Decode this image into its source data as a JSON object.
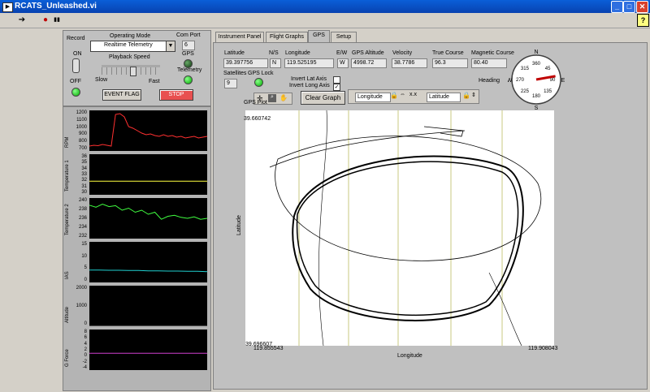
{
  "window": {
    "title": "RCATS_Unleashed.vi",
    "min": "_",
    "max": "□",
    "close": "✕",
    "help": "?"
  },
  "toolbar": {
    "run": "➔",
    "abort": "●",
    "pause": "▮▮"
  },
  "controls": {
    "record_label": "Record",
    "on_label": "ON",
    "off_label": "OFF",
    "operating_mode_label": "Operating Mode",
    "operating_mode_value": "Realtime Telemetry",
    "com_port_label": "Com Port",
    "com_port_value": "6",
    "gps_label": "GPS",
    "telemetry_label": "Telemetry",
    "playback_speed_label": "Playback Speed",
    "slow_label": "Slow",
    "fast_label": "Fast",
    "event_flag_label": "EVENT FLAG",
    "stop_label": "STOP"
  },
  "strip_charts": [
    {
      "name": "RPM",
      "ticks": [
        "1200",
        "1100",
        "1000",
        "900",
        "800",
        "700"
      ],
      "trace_color": "#ff3030",
      "values": [
        760,
        770,
        765,
        780,
        770,
        760,
        1150,
        1160,
        1120,
        1000,
        980,
        950,
        920,
        900,
        910,
        890,
        880,
        900,
        880,
        890,
        870,
        880,
        860,
        870,
        880,
        860,
        870,
        880
      ]
    },
    {
      "name": "Temperature 1",
      "ticks": [
        "36",
        "35",
        "34",
        "33",
        "32",
        "31",
        "30"
      ],
      "trace_color": "#ffff40",
      "values": [
        32,
        32,
        32,
        32,
        32,
        32,
        32,
        32,
        32,
        32,
        32,
        32,
        32,
        32
      ]
    },
    {
      "name": "Temperature 2",
      "ticks": [
        "240",
        "238",
        "236",
        "234",
        "232"
      ],
      "trace_color": "#40ff40",
      "values": [
        238.6,
        238.2,
        238.8,
        238.3,
        238.5,
        237.6,
        238.0,
        237.2,
        237.6,
        236.8,
        237.2,
        235.8,
        236.4,
        236.6,
        236.2,
        236.0,
        236.3,
        235.8,
        236.0
      ]
    },
    {
      "name": "IAS",
      "ticks": [
        "15",
        "10",
        "5",
        "0"
      ],
      "trace_color": "#20d0d0",
      "values": [
        4.6,
        4.6,
        4.5,
        4.5,
        4.4,
        4.4,
        4.3,
        4.3,
        4.2,
        4.2,
        4.1,
        4.1,
        4.0
      ]
    },
    {
      "name": "Altitude",
      "ticks": [
        "2000",
        "1000",
        "0"
      ],
      "trace_color": "#a0a0a0",
      "values": [
        0,
        0,
        0,
        0,
        0,
        0
      ]
    },
    {
      "name": "G Force",
      "ticks": [
        "8",
        "6",
        "4",
        "2",
        "0",
        "-2",
        "-4"
      ],
      "trace_color": "#d040d0",
      "values": [
        1,
        1,
        1,
        1,
        1,
        1,
        1,
        1,
        1,
        1,
        1,
        1,
        1,
        1
      ]
    }
  ],
  "tabs": [
    {
      "label": "Instrument Panel"
    },
    {
      "label": "Flight Graphs"
    },
    {
      "label": "GPS"
    },
    {
      "label": "Setup"
    }
  ],
  "gps": {
    "latitude_label": "Latitude",
    "latitude": "39.397756",
    "ns_label": "N/S",
    "ns": "N",
    "longitude_label": "Longitude",
    "longitude": "119.525195",
    "ew_label": "E/W",
    "ew": "W",
    "altitude_label": "GPS Altitude",
    "altitude": "4998.72",
    "velocity_label": "Velocity",
    "velocity": "38.7786",
    "true_course_label": "True Course",
    "true_course": "96.3",
    "mag_course_label": "Magnetic Course",
    "mag_course": "80.40",
    "satellites_label": "Satellites",
    "satellites": "9",
    "gps_lock_label": "GPS Lock",
    "invert_lat_label": "Invert Lat Axis",
    "invert_long_label": "Invert Long Axis",
    "invert_lat_checked": "",
    "invert_long_checked": "✓",
    "clear_graph_label": "Clear Graph",
    "gps_plot_label": "GPS Plot",
    "x_scale_name": "Longitude",
    "y_scale_name": "Latitude",
    "heading_label": "Heading",
    "compass": {
      "N": "N",
      "S": "S",
      "E": "E",
      "W": "W",
      "ticks": [
        "360",
        "45",
        "90",
        "135",
        "180",
        "225",
        "270",
        "315"
      ],
      "heading_deg": 80
    }
  },
  "chart_data": {
    "type": "line",
    "xlabel": "Longitude",
    "ylabel": "Latitude",
    "ymax_label": "39.660742",
    "ymin_label": "39.696607",
    "xmin_label": "119.855543",
    "xmax_label": "119.908043"
  }
}
